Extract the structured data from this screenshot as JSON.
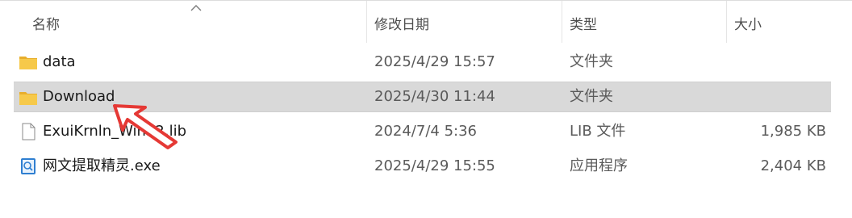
{
  "columns": {
    "name": "名称",
    "date": "修改日期",
    "type": "类型",
    "size": "大小"
  },
  "files": [
    {
      "name": "data",
      "date": "2025/4/29 15:57",
      "type": "文件夹",
      "size": "",
      "icon": "folder-icon",
      "selected": false
    },
    {
      "name": "Download",
      "date": "2025/4/30 11:44",
      "type": "文件夹",
      "size": "",
      "icon": "folder-icon",
      "selected": true
    },
    {
      "name": "ExuiKrnln_Win32.lib",
      "date": "2024/7/4 5:36",
      "type": "LIB 文件",
      "size": "1,985 KB",
      "icon": "file-icon",
      "selected": false
    },
    {
      "name": "网文提取精灵.exe",
      "date": "2025/4/29 15:55",
      "type": "应用程序",
      "size": "2,404 KB",
      "icon": "app-icon",
      "selected": false
    }
  ],
  "colors": {
    "selection": "#d9d9d9",
    "folder": "#f4c243",
    "arrow": "#e53935"
  }
}
